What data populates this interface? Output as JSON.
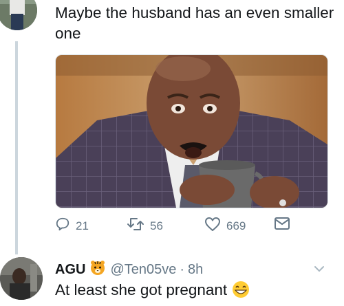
{
  "tweet1": {
    "text": "Maybe the husband has an even smaller one",
    "actions": {
      "reply_count": "21",
      "retweet_count": "56",
      "like_count": "669"
    }
  },
  "tweet2": {
    "name": "AGU",
    "handle": "@Ten05ve",
    "separator": "·",
    "time": "8h",
    "text": "At least she got pregnant"
  },
  "icons": {
    "reply": "reply-icon",
    "retweet": "retweet-icon",
    "like": "heart-icon",
    "dm": "envelope-icon",
    "chevron": "chevron-down-icon",
    "tiger": "tiger-emoji",
    "grin": "grinning-emoji"
  },
  "colors": {
    "text": "#14171a",
    "secondary": "#657786",
    "thread_line": "#ccd6dd"
  }
}
